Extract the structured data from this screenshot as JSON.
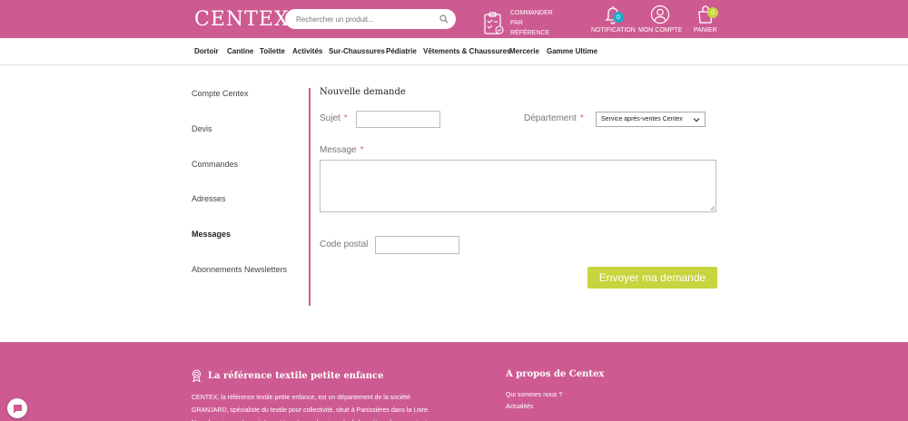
{
  "header": {
    "logo_text": "CENTEX",
    "search_placeholder": "Rechercher un produit...",
    "order_ref_line1": "COMMANDER PAR",
    "order_ref_line2": "RÉFÉRENCE",
    "notification_label": "NOTIFICATION",
    "notification_count": "0",
    "account_label": "MON COMPTE",
    "cart_label": "PANIER",
    "cart_count": "0"
  },
  "nav": {
    "items": [
      {
        "label": "Dortoir"
      },
      {
        "label": "Cantine"
      },
      {
        "label": "Toilette"
      },
      {
        "label": "Activités"
      },
      {
        "label": "Sur-Chaussures"
      },
      {
        "label": "Pédiatrie"
      },
      {
        "label": "Vêtements & Chaussures"
      },
      {
        "label": "Mercerie"
      },
      {
        "label": "Gamme Ultime"
      }
    ]
  },
  "sidebar": {
    "items": [
      {
        "label": "Compte Centex"
      },
      {
        "label": "Devis"
      },
      {
        "label": "Commandes"
      },
      {
        "label": "Adresses"
      },
      {
        "label": "Messages"
      },
      {
        "label": "Abonnements Newsletters"
      }
    ]
  },
  "form": {
    "title": "Nouvelle demande",
    "subject_label": "Sujet",
    "department_label": "Département",
    "department_value": "Service après-ventes Centex",
    "message_label": "Message",
    "postal_label": "Code postal",
    "required_mark": "*",
    "submit_label": "Envoyer ma demande"
  },
  "footer": {
    "left_title": "La référence textile petite enfance",
    "left_text": "CENTEX, la référence textile petite enfance, est un département de la société GRANJARD, spécialiste du textile pour collectivité, situé à Panissières dans la Loire. Nous fournissons les crèches et tous les professionnels de la petite enfance partout",
    "right_title": "A propos de Centex",
    "links": [
      {
        "label": "Qui sommes nous ?"
      },
      {
        "label": "Actualités"
      }
    ]
  },
  "colors": {
    "brand_pink": "#cd5b91",
    "accent_green": "#c7d43e",
    "badge_teal": "#1ea8c6",
    "badge_lime": "#c7d43e"
  }
}
